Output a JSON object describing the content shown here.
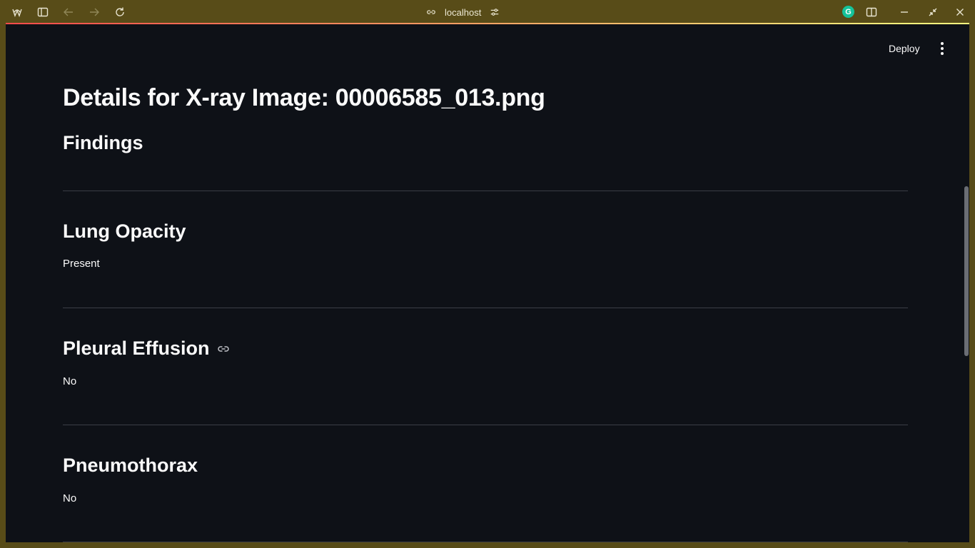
{
  "browser": {
    "url": "localhost",
    "grammarly_letter": "G"
  },
  "app": {
    "deploy_label": "Deploy",
    "page_title": "Details for X-ray Image: 00006585_013.png",
    "section_heading": "Findings",
    "findings": [
      {
        "name": "Lung Opacity",
        "value": "Present"
      },
      {
        "name": "Pleural Effusion",
        "value": "No"
      },
      {
        "name": "Pneumothorax",
        "value": "No"
      }
    ]
  },
  "colors": {
    "chrome_background": "#584c18",
    "app_background": "#0e1117",
    "text": "#fafafa",
    "divider": "#3b3e46",
    "decoration_start": "#ff4b4b",
    "decoration_end": "#fffd80"
  },
  "icons": [
    "app-logo-icon",
    "sidebar-toggle-icon",
    "back-icon",
    "forward-icon",
    "reload-icon",
    "link-icon",
    "site-settings-icon",
    "split-view-icon",
    "minimize-icon",
    "restore-icon",
    "close-icon",
    "more-vertical-icon"
  ]
}
